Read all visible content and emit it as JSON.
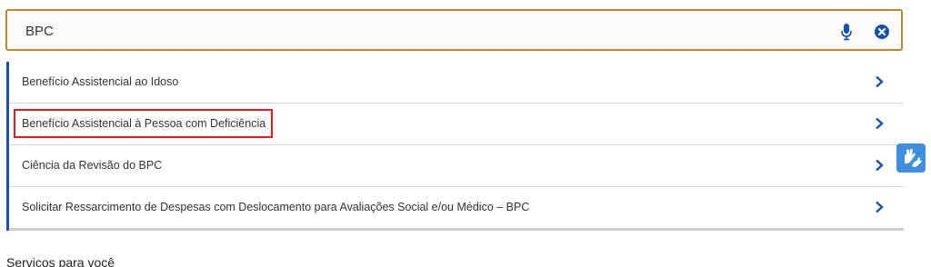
{
  "search": {
    "value": "BPC",
    "placeholder": ""
  },
  "icons": {
    "mic": "microphone-icon",
    "clear": "clear-circle-x-icon",
    "chevron": "chevron-right-icon",
    "libras": "sign-language-hands-icon"
  },
  "results": [
    {
      "label": "Benefício Assistencial ao Idoso"
    },
    {
      "label": "Benefício Assistencial à Pessoa com Deficiência",
      "highlighted": true
    },
    {
      "label": "Ciência da Revisão do BPC"
    },
    {
      "label": "Solicitar Ressarcimento de Despesas com Deslocamento para Avaliações Social e/ou Médico – BPC"
    }
  ],
  "section": {
    "title": "Serviços para você"
  },
  "colors": {
    "search_border": "#b78b2a",
    "accent_blue": "#1351b4",
    "highlight_red": "#e8191f",
    "libras_button": "#3f8fe0"
  }
}
